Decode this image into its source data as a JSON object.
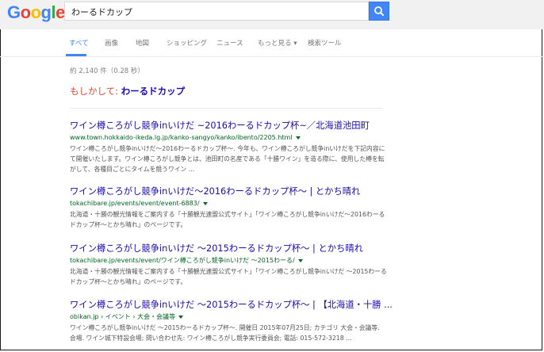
{
  "logo": {
    "letters": [
      "G",
      "o",
      "o",
      "g",
      "l",
      "e"
    ]
  },
  "search": {
    "query": "わーるドカップ"
  },
  "tabs": [
    {
      "label": "すべて",
      "active": true
    },
    {
      "label": "画像",
      "active": false
    },
    {
      "label": "地図",
      "active": false
    },
    {
      "label": "ショッピング",
      "active": false
    },
    {
      "label": "ニュース",
      "active": false
    },
    {
      "label": "もっと見る ▾",
      "active": false
    },
    {
      "label": "検索ツール",
      "active": false
    }
  ],
  "stats": "約 2,140 件（0.28 秒）",
  "suggestion": {
    "label": "もしかして: ",
    "query": "わーるドカップ"
  },
  "results": [
    {
      "title": "ワイン樽ころがし競争inいけだ ~2016わーるドカップ杯~／北海道池田町",
      "url": "www.town.hokkaido-ikeda.lg.jp/kanko-sangyo/kanko/ibento/2205.html",
      "snippet": "ワイン樽ころがし競争inいけだ～2016わーるドカップ杯～. 今年も、ワイン樽ころがし競争inいけだを下記内容にて開催いたします。ワイン樽ころがし競争とは、池田町の名産である「十勝ワイン」を造る際に、使用した樽を転がして、各種目ごとにタイムを競うワイン ..."
    },
    {
      "title": "ワイン樽ころがし競争inいけだ～2016わーるドカップ杯～ | とかち晴れ",
      "url": "tokachibare.jp/events/event/event-6883/",
      "snippet": "北海道・十勝の観光情報をご案内する「十勝観光連盟公式サイト」「ワイン樽ころがし競争inいけだ～2016わーるドカップ杯～とかち晴れ」のページです。"
    },
    {
      "title": "ワイン樽ころがし競争inいけだ ～2015わーるドカップ杯～ | とかち晴れ",
      "url": "tokachibare.jp/events/event/ワイン樽ころがし競争inいけだ ～2015わーる/",
      "snippet": "北海道・十勝の観光情報をご案内する「十勝観光連盟公式サイト」「ワイン樽ころがし競争inいけだ ～2015わーるドカップ杯～とかち晴れ」のページです。"
    },
    {
      "title": "ワイン樽ころがし競争inいけだ ～2015わーるドカップ杯～ | 【北海道・十勝 ...",
      "url": "obikan.jp › イベント › 大会・会議等",
      "snippet": "ワイン樽ころがし競争inいけだ ～2015わーるドカップ杯～. 開催日 2015年07月25日; カテゴリ 大会・会議等. 会場. ワイン城下特設会場; 問い合わせ先: ワイン樽ころがし競争実行委員会; 電話: 015-572-3218 ..."
    }
  ]
}
